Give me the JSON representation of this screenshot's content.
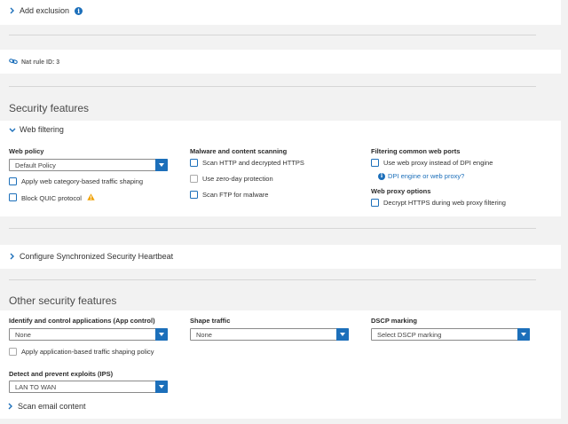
{
  "add_exclusion": {
    "label": "Add exclusion"
  },
  "nat_rule": {
    "label": "Nat rule ID: 3"
  },
  "security_features": {
    "title": "Security features",
    "web_filtering": {
      "toggle_label": "Web filtering",
      "web_policy": {
        "label": "Web policy",
        "selected": "Default Policy",
        "apply_traffic_shaping": "Apply web category-based traffic shaping",
        "block_quic": "Block QUIC protocol"
      },
      "malware": {
        "label": "Malware and content scanning",
        "scan_http": "Scan HTTP and decrypted HTTPS",
        "zero_day": "Use zero-day protection",
        "scan_ftp": "Scan FTP for malware"
      },
      "ports": {
        "label": "Filtering common web ports",
        "use_proxy": "Use web proxy instead of DPI engine",
        "dpi_link": "DPI engine or web proxy?"
      },
      "proxy_options": {
        "label": "Web proxy options",
        "decrypt_https": "Decrypt HTTPS during web proxy filtering"
      }
    }
  },
  "heartbeat": {
    "label": "Configure Synchronized Security Heartbeat"
  },
  "other_security": {
    "title": "Other security features",
    "app_control": {
      "label": "Identify and control applications (App control)",
      "selected": "None",
      "apply_shaping": "Apply application-based traffic shaping policy"
    },
    "shape_traffic": {
      "label": "Shape traffic",
      "selected": "None"
    },
    "dscp": {
      "label": "DSCP marking",
      "selected": "Select DSCP marking"
    },
    "ips": {
      "label": "Detect and prevent exploits (IPS)",
      "selected": "LAN TO WAN"
    },
    "scan_email": {
      "label": "Scan email content"
    }
  },
  "colors": {
    "accent": "#1c6fba",
    "warning": "#f0a30a"
  }
}
